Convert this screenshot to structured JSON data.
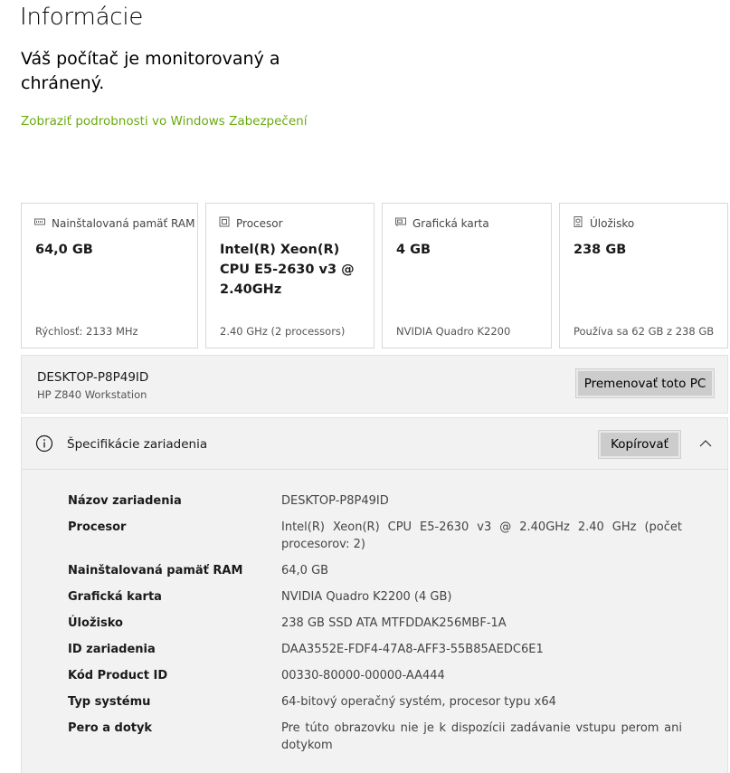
{
  "page": {
    "title": "Informácie",
    "status": "Váš počítač je monitorovaný a chránený.",
    "security_link": "Zobraziť podrobnosti vo Windows Zabezpečení"
  },
  "cards": [
    {
      "icon": "memory-icon",
      "label": "Nainštalovaná pamäť RAM",
      "value": "64,0 GB",
      "sub": "Rýchlosť: 2133 MHz"
    },
    {
      "icon": "processor-icon",
      "label": "Procesor",
      "value": "Intel(R) Xeon(R) CPU E5-2630 v3 @ 2.40GHz",
      "sub": "2.40 GHz (2 processors)"
    },
    {
      "icon": "graphics-card-icon",
      "label": "Grafická karta",
      "value": "4 GB",
      "sub": "NVIDIA Quadro K2200"
    },
    {
      "icon": "storage-icon",
      "label": "Úložisko",
      "value": "238 GB",
      "sub": "Používa sa 62 GB z 238 GB"
    }
  ],
  "pc": {
    "name": "DESKTOP-P8P49ID",
    "model": "HP Z840 Workstation",
    "rename_label": "Premenovať toto PC"
  },
  "specs": {
    "title": "Špecifikácie zariadenia",
    "copy_label": "Kopírovať",
    "rows": [
      {
        "key": "Názov zariadenia",
        "value": "DESKTOP-P8P49ID"
      },
      {
        "key": "Procesor",
        "value": "Intel(R) Xeon(R) CPU E5-2630 v3 @ 2.40GHz   2.40 GHz (počet procesorov: 2)"
      },
      {
        "key": "Nainštalovaná pamäť RAM",
        "value": "64,0 GB"
      },
      {
        "key": "Grafická karta",
        "value": "NVIDIA Quadro K2200 (4 GB)"
      },
      {
        "key": "Úložisko",
        "value": "238 GB SSD ATA MTFDDAK256MBF-1A"
      },
      {
        "key": "ID zariadenia",
        "value": "DAA3552E-FDF4-47A8-AFF3-55B85AEDC6E1"
      },
      {
        "key": "Kód Product ID",
        "value": "00330-80000-00000-AA444"
      },
      {
        "key": "Typ systému",
        "value": "64-bitový operačný systém, procesor typu x64"
      },
      {
        "key": "Pero a dotyk",
        "value": "Pre túto obrazovku nie je k dispozícii zadávanie vstupu perom ani dotykom"
      }
    ]
  },
  "colors": {
    "link": "#6aaa0f",
    "panel": "#f2f2f2",
    "button": "#cccccc"
  }
}
